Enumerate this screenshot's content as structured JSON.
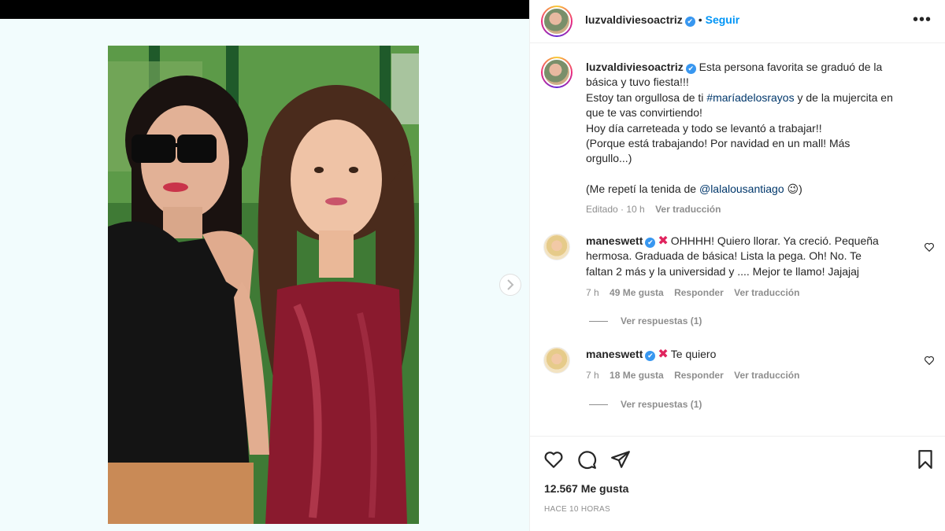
{
  "post": {
    "author": "luzvaldiviesoactriz",
    "follow_label": "Seguir",
    "separator": "•",
    "more_label": "•••"
  },
  "caption": {
    "author": "luzvaldiviesoactriz",
    "line1": "Esta persona favorita se graduó de la",
    "line2": "básica y tuvo fiesta!!!",
    "line3_pre": "Estoy tan orgullosa de ti ",
    "line3_hashtag": "#maríadelosrayos",
    "line3_post": " y de la mujercita en",
    "line4": "que te vas convirtiendo!",
    "line5": "Hoy día carreteada y todo se levantó a trabajar!!",
    "line6": "(Porque está trabajando! Por navidad en un mall! Más",
    "line7": "orgullo...)",
    "line8_pre": "(Me repetí la tenida de ",
    "line8_mention": "@lalalousantiago",
    "line8_emoji": "😉",
    "line8_post": ")",
    "edited": "Editado · 10 h",
    "see_translation": "Ver traducción"
  },
  "comments": [
    {
      "user": "maneswett",
      "line1": "OHHHH! Quiero llorar. Ya creció. Pequeña",
      "line2": "hermosa. Graduada de básica! Lista la pega. Oh! No. Te",
      "line3": "faltan 2 más y la universidad y .... Mejor te llamo! Jajajaj",
      "time": "7 h",
      "likes": "49 Me gusta",
      "reply": "Responder",
      "translate": "Ver traducción",
      "replies": "Ver respuestas (1)"
    },
    {
      "user": "maneswett",
      "line1": "Te quiero",
      "time": "7 h",
      "likes": "18 Me gusta",
      "reply": "Responder",
      "translate": "Ver traducción",
      "replies": "Ver respuestas (1)"
    }
  ],
  "footer": {
    "likes": "12.567 Me gusta",
    "time": "HACE 10 HORAS"
  },
  "icons": {
    "verified": "✔",
    "x_mark": "✖"
  },
  "colors": {
    "link_blue": "#0095f6",
    "verified_blue": "#3897f0",
    "hashtag": "#00376b",
    "muted": "#8e8e8e"
  }
}
